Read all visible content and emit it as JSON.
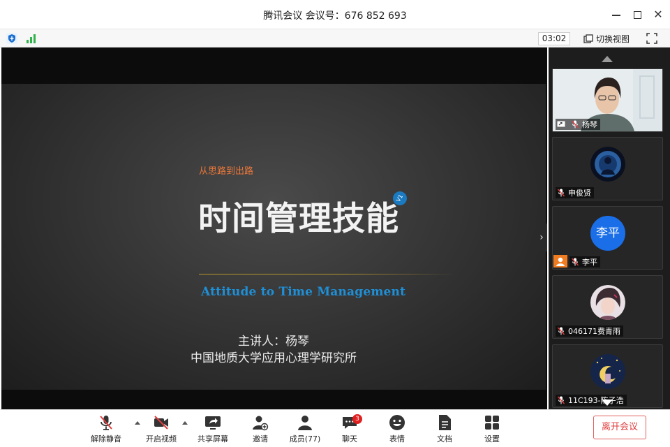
{
  "window": {
    "title": "腾讯会议 会议号：676 852 693",
    "close_glyph": "✕"
  },
  "status": {
    "timer": "03:02",
    "switch_view_label": "切换视图"
  },
  "slide": {
    "subtitle": "从思路到出路",
    "title": "时间管理技能",
    "badge": "V1",
    "english": "Attitude to Time Management",
    "presenter": "主讲人：杨琴",
    "organization": "中国地质大学应用心理学研究所",
    "collapse_glyph": "›"
  },
  "participants": [
    {
      "name": "杨琴",
      "type": "video"
    },
    {
      "name": "申俊贤",
      "type": "avatar"
    },
    {
      "name": "李平",
      "type": "avatar-text",
      "avatar_text": "李平"
    },
    {
      "name": "046171费青雨",
      "type": "avatar"
    },
    {
      "name": "11C193-陈子浩",
      "type": "avatar"
    }
  ],
  "toolbar": {
    "unmute": "解除静音",
    "start_video": "开启视频",
    "share_screen": "共享屏幕",
    "invite": "邀请",
    "members": "成员(77)",
    "chat": "聊天",
    "chat_badge": "3",
    "reactions": "表情",
    "docs": "文档",
    "settings": "设置",
    "leave": "离开会议"
  },
  "colors": {
    "accent_blue": "#1b7ac0",
    "leave_red": "#e03c3c",
    "slide_orange": "#e7763a"
  }
}
